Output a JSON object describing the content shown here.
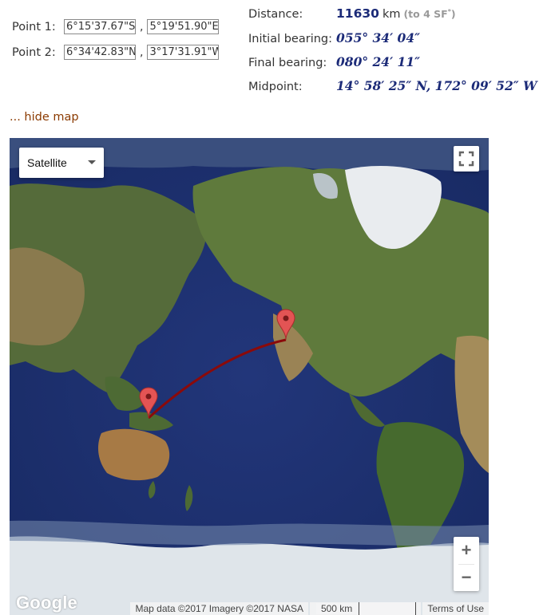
{
  "point1": {
    "label": "Point 1:",
    "lat": "6°15'37.67\"S",
    "lon": "-5°19'51.90\"E",
    "lat_shown": "6°15'37.67\"S",
    "lon_shown": "5°19'51.90\"E"
  },
  "point2": {
    "label": "Point 2:",
    "lat_shown": "6°34'42.83\"N",
    "lon_shown": "3°17'31.91\"W"
  },
  "comma": ",",
  "results": {
    "distance_label": "Distance:",
    "distance_value": "11630",
    "distance_unit": "km",
    "distance_sf": "(to 4 SF",
    "distance_sf_sup": "*",
    "distance_sf_end": ")",
    "initial_label": "Initial bearing:",
    "initial_value": "055° 34′ 04″",
    "final_label": "Final bearing:",
    "final_value": "080° 24′ 11″",
    "midpoint_label": "Midpoint:",
    "midpoint_value": "14° 58′ 25″ N, 172° 09′ 52″ W"
  },
  "hide_map_link": "... hide map",
  "map": {
    "map_type": "Satellite",
    "zoom_in": "+",
    "zoom_out": "−",
    "logo": "Google",
    "attribution": "Map data ©2017 Imagery ©2017 NASA",
    "scale_label": "500 km",
    "terms": "Terms of Use",
    "marker_color": "#e35454",
    "route_color": "#8b0a0a",
    "icons": {
      "fullscreen": "fullscreen-icon",
      "marker": "map-marker-icon",
      "caret": "chevron-down-icon"
    }
  }
}
